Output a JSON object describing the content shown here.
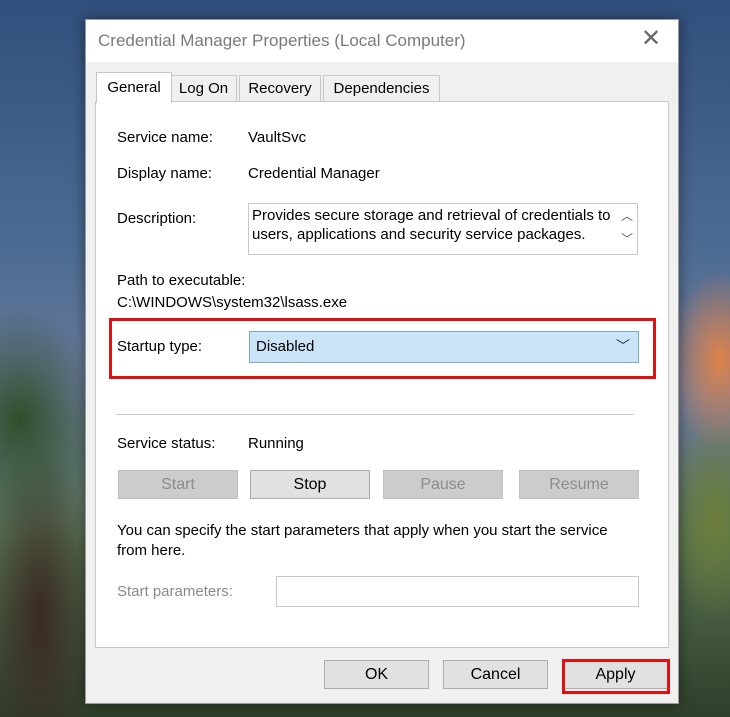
{
  "dialog": {
    "title": "Credential Manager Properties (Local Computer)",
    "close_glyph": "✕"
  },
  "tabs": [
    {
      "label": "General",
      "active": true
    },
    {
      "label": "Log On",
      "active": false
    },
    {
      "label": "Recovery",
      "active": false
    },
    {
      "label": "Dependencies",
      "active": false
    }
  ],
  "general": {
    "service_name_label": "Service name:",
    "service_name_value": "VaultSvc",
    "display_name_label": "Display name:",
    "display_name_value": "Credential Manager",
    "description_label": "Description:",
    "description_value": "Provides secure storage and retrieval of credentials to users, applications and security service packages.",
    "path_label": "Path to executable:",
    "path_value": "C:\\WINDOWS\\system32\\lsass.exe",
    "startup_type_label": "Startup type:",
    "startup_type_value": "Disabled",
    "service_status_label": "Service status:",
    "service_status_value": "Running",
    "buttons": {
      "start": "Start",
      "stop": "Stop",
      "pause": "Pause",
      "resume": "Resume"
    },
    "hint_text": "You can specify the start parameters that apply when you start the service from here.",
    "start_params_label": "Start parameters:",
    "start_params_value": ""
  },
  "footer": {
    "ok": "OK",
    "cancel": "Cancel",
    "apply": "Apply"
  },
  "colors": {
    "highlight": "#e01010",
    "select_bg": "#cce4f7"
  },
  "icons": {
    "close": "close-icon",
    "dropdown": "chevron-down-icon",
    "scroll_up": "chevron-up-icon",
    "scroll_down": "chevron-down-icon"
  }
}
